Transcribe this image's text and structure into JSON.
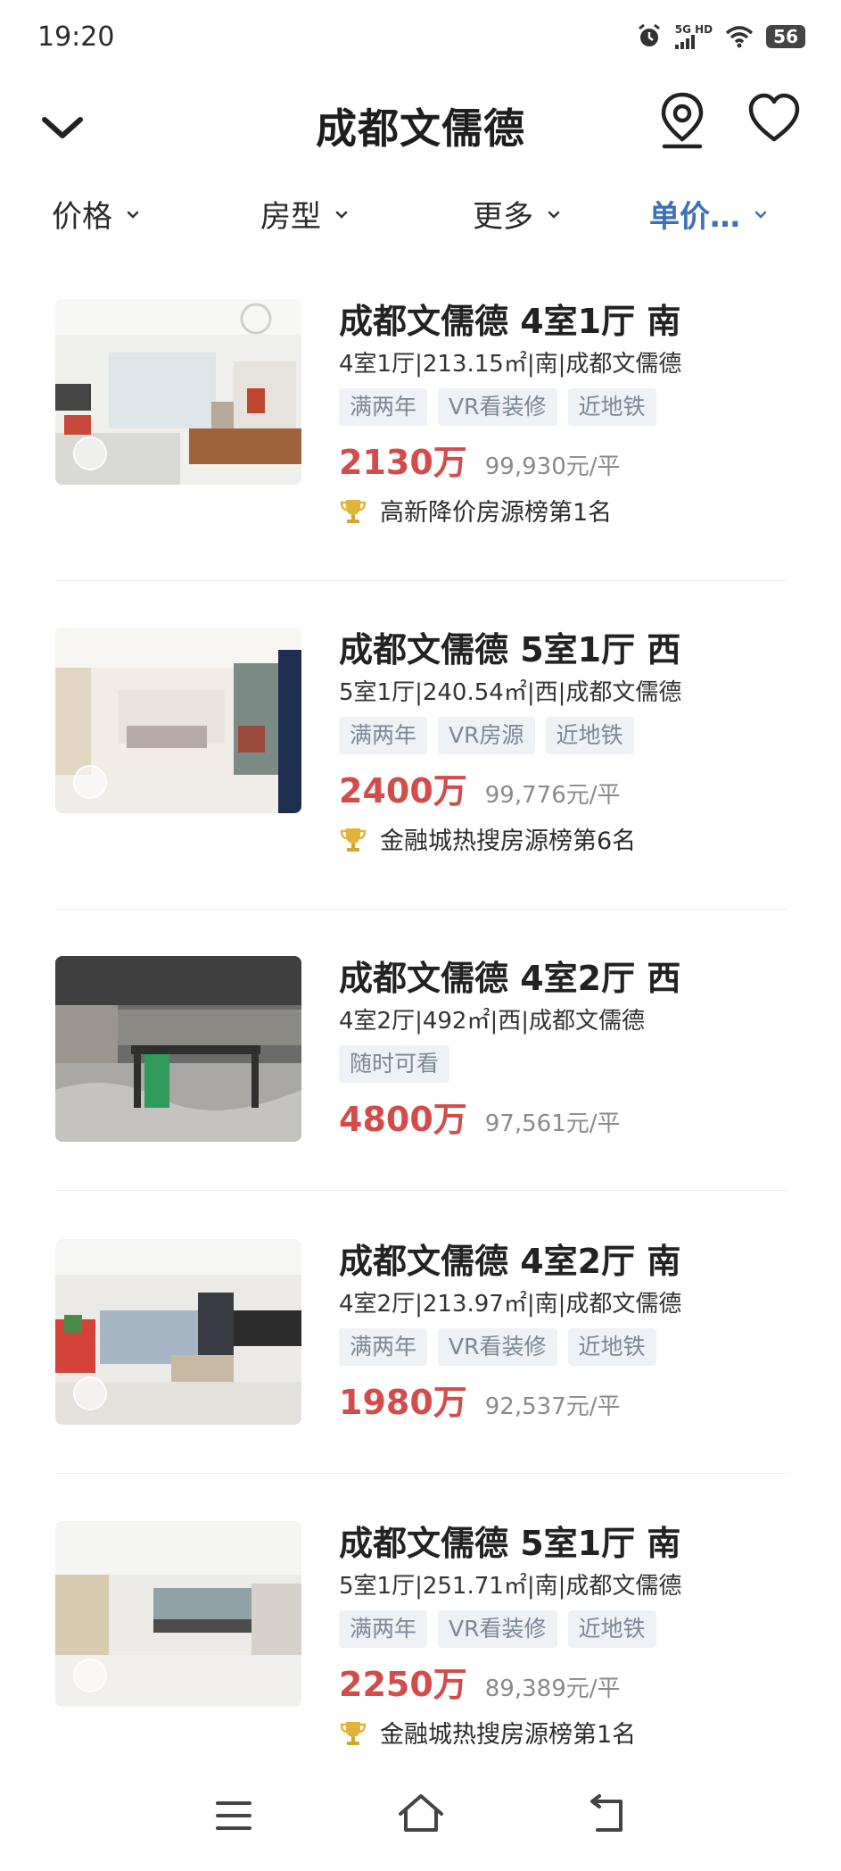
{
  "status": {
    "time": "19:20",
    "net_top": "5G",
    "net_side": "HD",
    "battery": "56"
  },
  "header": {
    "title": "成都文儒德"
  },
  "filters": [
    {
      "label": "价格",
      "active": false
    },
    {
      "label": "房型",
      "active": false
    },
    {
      "label": "更多",
      "active": false
    },
    {
      "label": "单价…",
      "active": true
    }
  ],
  "accent_color": "#3f6fb5",
  "price_color": "#d24c4c",
  "listings": [
    {
      "title": "成都文儒德 4室1厅 南",
      "desc": "4室1厅|213.15㎡|南|成都文儒德",
      "tags": [
        "满两年",
        "VR看装修",
        "近地铁"
      ],
      "price": "2130万",
      "unit_price": "99,930元/平",
      "rank": "高新降价房源榜第1名"
    },
    {
      "title": "成都文儒德 5室1厅 西",
      "desc": "5室1厅|240.54㎡|西|成都文儒德",
      "tags": [
        "满两年",
        "VR房源",
        "近地铁"
      ],
      "price": "2400万",
      "unit_price": "99,776元/平",
      "rank": "金融城热搜房源榜第6名"
    },
    {
      "title": "成都文儒德 4室2厅 西",
      "desc": "4室2厅|492㎡|西|成都文儒德",
      "tags": [
        "随时可看"
      ],
      "price": "4800万",
      "unit_price": "97,561元/平",
      "rank": ""
    },
    {
      "title": "成都文儒德 4室2厅 南",
      "desc": "4室2厅|213.97㎡|南|成都文儒德",
      "tags": [
        "满两年",
        "VR看装修",
        "近地铁"
      ],
      "price": "1980万",
      "unit_price": "92,537元/平",
      "rank": ""
    },
    {
      "title": "成都文儒德 5室1厅 南",
      "desc": "5室1厅|251.71㎡|南|成都文儒德",
      "tags": [
        "满两年",
        "VR看装修",
        "近地铁"
      ],
      "price": "2250万",
      "unit_price": "89,389元/平",
      "rank": "金融城热搜房源榜第1名"
    }
  ]
}
